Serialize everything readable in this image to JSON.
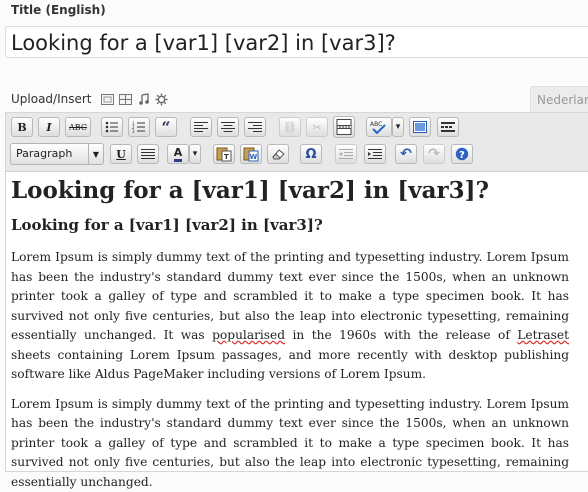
{
  "title_section": {
    "label": "Title (English)",
    "value": "Looking for a [var1] [var2] in [var3]?"
  },
  "media": {
    "upload_label": "Upload/Insert",
    "icons": [
      "image-icon",
      "video-icon",
      "audio-icon",
      "media-icon"
    ]
  },
  "language_tab": {
    "label": "Nederlands"
  },
  "toolbar": {
    "row1": [
      {
        "name": "bold-button",
        "glyph": "B"
      },
      {
        "name": "italic-button",
        "glyph": "I"
      },
      {
        "name": "strikethrough-button",
        "glyph": "ABC"
      },
      {
        "name": "bullet-list-button",
        "glyph": "≔"
      },
      {
        "name": "numbered-list-button",
        "glyph": "⒈"
      },
      {
        "name": "blockquote-button",
        "glyph": "“"
      },
      {
        "name": "align-left-button",
        "glyph": "≡"
      },
      {
        "name": "align-center-button",
        "glyph": "≡"
      },
      {
        "name": "align-right-button",
        "glyph": "≡"
      },
      {
        "name": "insert-link-button",
        "glyph": "⛓"
      },
      {
        "name": "unlink-button",
        "glyph": "✂"
      },
      {
        "name": "insert-more-button",
        "glyph": "▭"
      },
      {
        "name": "spellcheck-button",
        "glyph": "ABC✓"
      },
      {
        "name": "spellcheck-dropdown",
        "glyph": "▾"
      },
      {
        "name": "fullscreen-button",
        "glyph": "▣"
      },
      {
        "name": "kitchen-sink-button",
        "glyph": "▦"
      }
    ],
    "row2": [
      {
        "name": "underline-button",
        "glyph": "U"
      },
      {
        "name": "justify-button",
        "glyph": "≣"
      },
      {
        "name": "text-color-button",
        "glyph": "A"
      },
      {
        "name": "text-color-dropdown",
        "glyph": "▾"
      },
      {
        "name": "paste-text-button",
        "glyph": "T"
      },
      {
        "name": "paste-word-button",
        "glyph": "W"
      },
      {
        "name": "remove-format-button",
        "glyph": "⌫"
      },
      {
        "name": "special-character-button",
        "glyph": "Ω"
      },
      {
        "name": "outdent-button",
        "glyph": "⇤"
      },
      {
        "name": "indent-button",
        "glyph": "⇥"
      },
      {
        "name": "undo-button",
        "glyph": "↶"
      },
      {
        "name": "redo-button",
        "glyph": "↷"
      },
      {
        "name": "help-button",
        "glyph": "?"
      }
    ],
    "format_select": "Paragraph"
  },
  "content": {
    "heading1": "Looking for a [var1] [var2] in [var3]?",
    "heading2": "Looking for a [var1] [var2] in [var3]?",
    "paragraph1_part1": "Lorem Ipsum is simply dummy text of the printing and typesetting industry. Lorem Ipsum has been the industry's standard dummy text ever since the 1500s, when an unknown printer took a galley of type and scrambled it to make a type specimen book. It has survived not only five centuries, but also the leap into electronic typesetting, remaining essentially unchanged. It was ",
    "paragraph1_spell1": "popularised",
    "paragraph1_part2": " in the 1960s with the release of ",
    "paragraph1_spell2": "Letraset",
    "paragraph1_part3": " sheets containing Lorem Ipsum passages, and more recently with desktop publishing software like Aldus PageMaker including versions of Lorem Ipsum.",
    "paragraph2": "Lorem Ipsum is simply dummy text of the printing and typesetting industry. Lorem Ipsum has been the industry's standard dummy text ever since the 1500s, when an unknown printer took a galley of type and scrambled it to make a type specimen book. It has survived not only five centuries, but also the leap into electronic typesetting, remaining essentially unchanged."
  }
}
